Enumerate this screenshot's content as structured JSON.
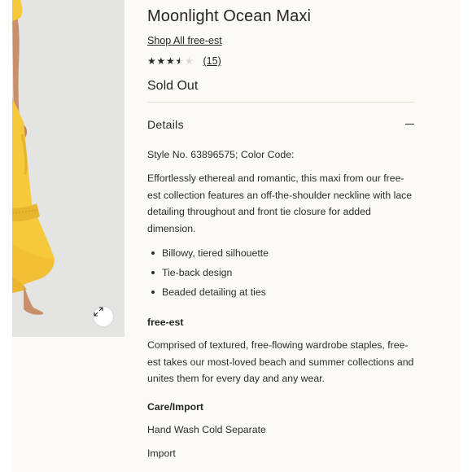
{
  "product": {
    "title": "Moonlight Ocean Maxi",
    "shop_link": "Shop All free-est",
    "rating": {
      "value": 3.5,
      "max": 5,
      "count_label": "(15)"
    },
    "availability": "Sold Out"
  },
  "image": {
    "zoom_icon": "expand-arrows-icon",
    "dress_color": "#f6c93b"
  },
  "details": {
    "header": "Details",
    "style_line": "Style No. 63896575; Color Code:",
    "description": "Effortlessly ethereal and romantic, this maxi from our free-est collection features an off-the-shoulder neckline with lace detailing throughout and front tie closure for added dimension.",
    "bullets": [
      "Billowy, tiered silhouette",
      "Tie-back design",
      "Beaded detailing at ties"
    ],
    "brand_heading": "free-est",
    "brand_text": "Comprised of textured, free-flowing wardrobe staples, free-est takes our most-loved beach and summer collections and unites them for every day and any wear.",
    "care_heading": "Care/Import",
    "care_lines": [
      "Hand Wash Cold Separate",
      "Import"
    ]
  }
}
